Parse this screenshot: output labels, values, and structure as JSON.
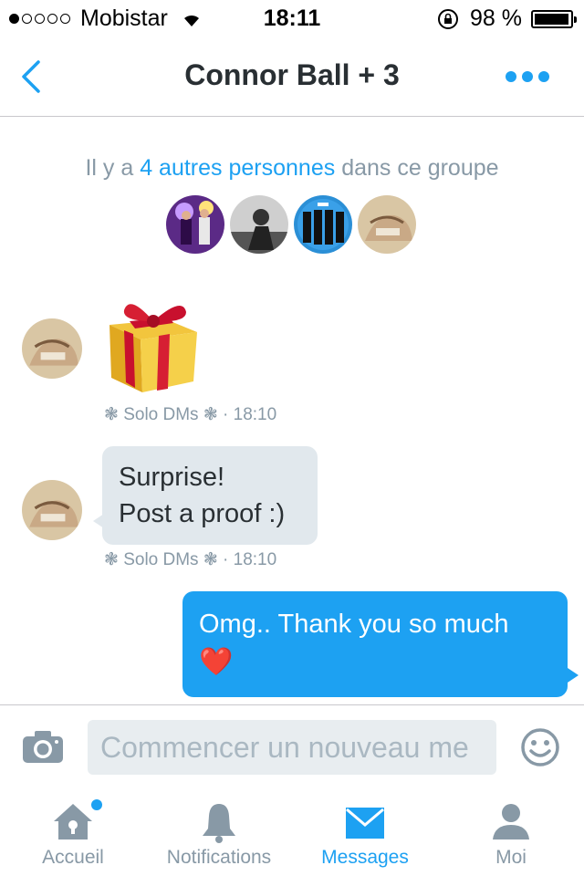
{
  "status_bar": {
    "carrier": "Mobistar",
    "time": "18:11",
    "battery": "98 %",
    "signal_bars_filled": 1,
    "signal_bars_total": 5,
    "battery_level": 0.98
  },
  "header": {
    "title": "Connor Ball + 3"
  },
  "group_info": {
    "prefix": "Il y a",
    "link": "4 autres personnes",
    "suffix": "dans ce groupe",
    "member_count": 4
  },
  "messages": [
    {
      "direction": "incoming",
      "type": "emoji",
      "emoji": "gift",
      "meta": "❃ Solo DMs ❃ · 18:10"
    },
    {
      "direction": "incoming",
      "type": "text",
      "lines": [
        "Surprise!",
        "Post a proof :)"
      ],
      "meta": "❃ Solo DMs ❃ · 18:10"
    },
    {
      "direction": "outgoing",
      "type": "text",
      "text": "Omg.. Thank you so much",
      "emoji": "❤️"
    }
  ],
  "composer": {
    "placeholder": "Commencer un nouveau me"
  },
  "tabs": [
    {
      "label": "Accueil",
      "icon": "home-icon",
      "active": false,
      "badge": true
    },
    {
      "label": "Notifications",
      "icon": "bell-icon",
      "active": false,
      "badge": false
    },
    {
      "label": "Messages",
      "icon": "envelope-icon",
      "active": true,
      "badge": false
    },
    {
      "label": "Moi",
      "icon": "person-icon",
      "active": false,
      "badge": false
    }
  ],
  "colors": {
    "accent": "#1da1f2",
    "bubble_in": "#e1e8ed",
    "muted": "#8899a6"
  }
}
